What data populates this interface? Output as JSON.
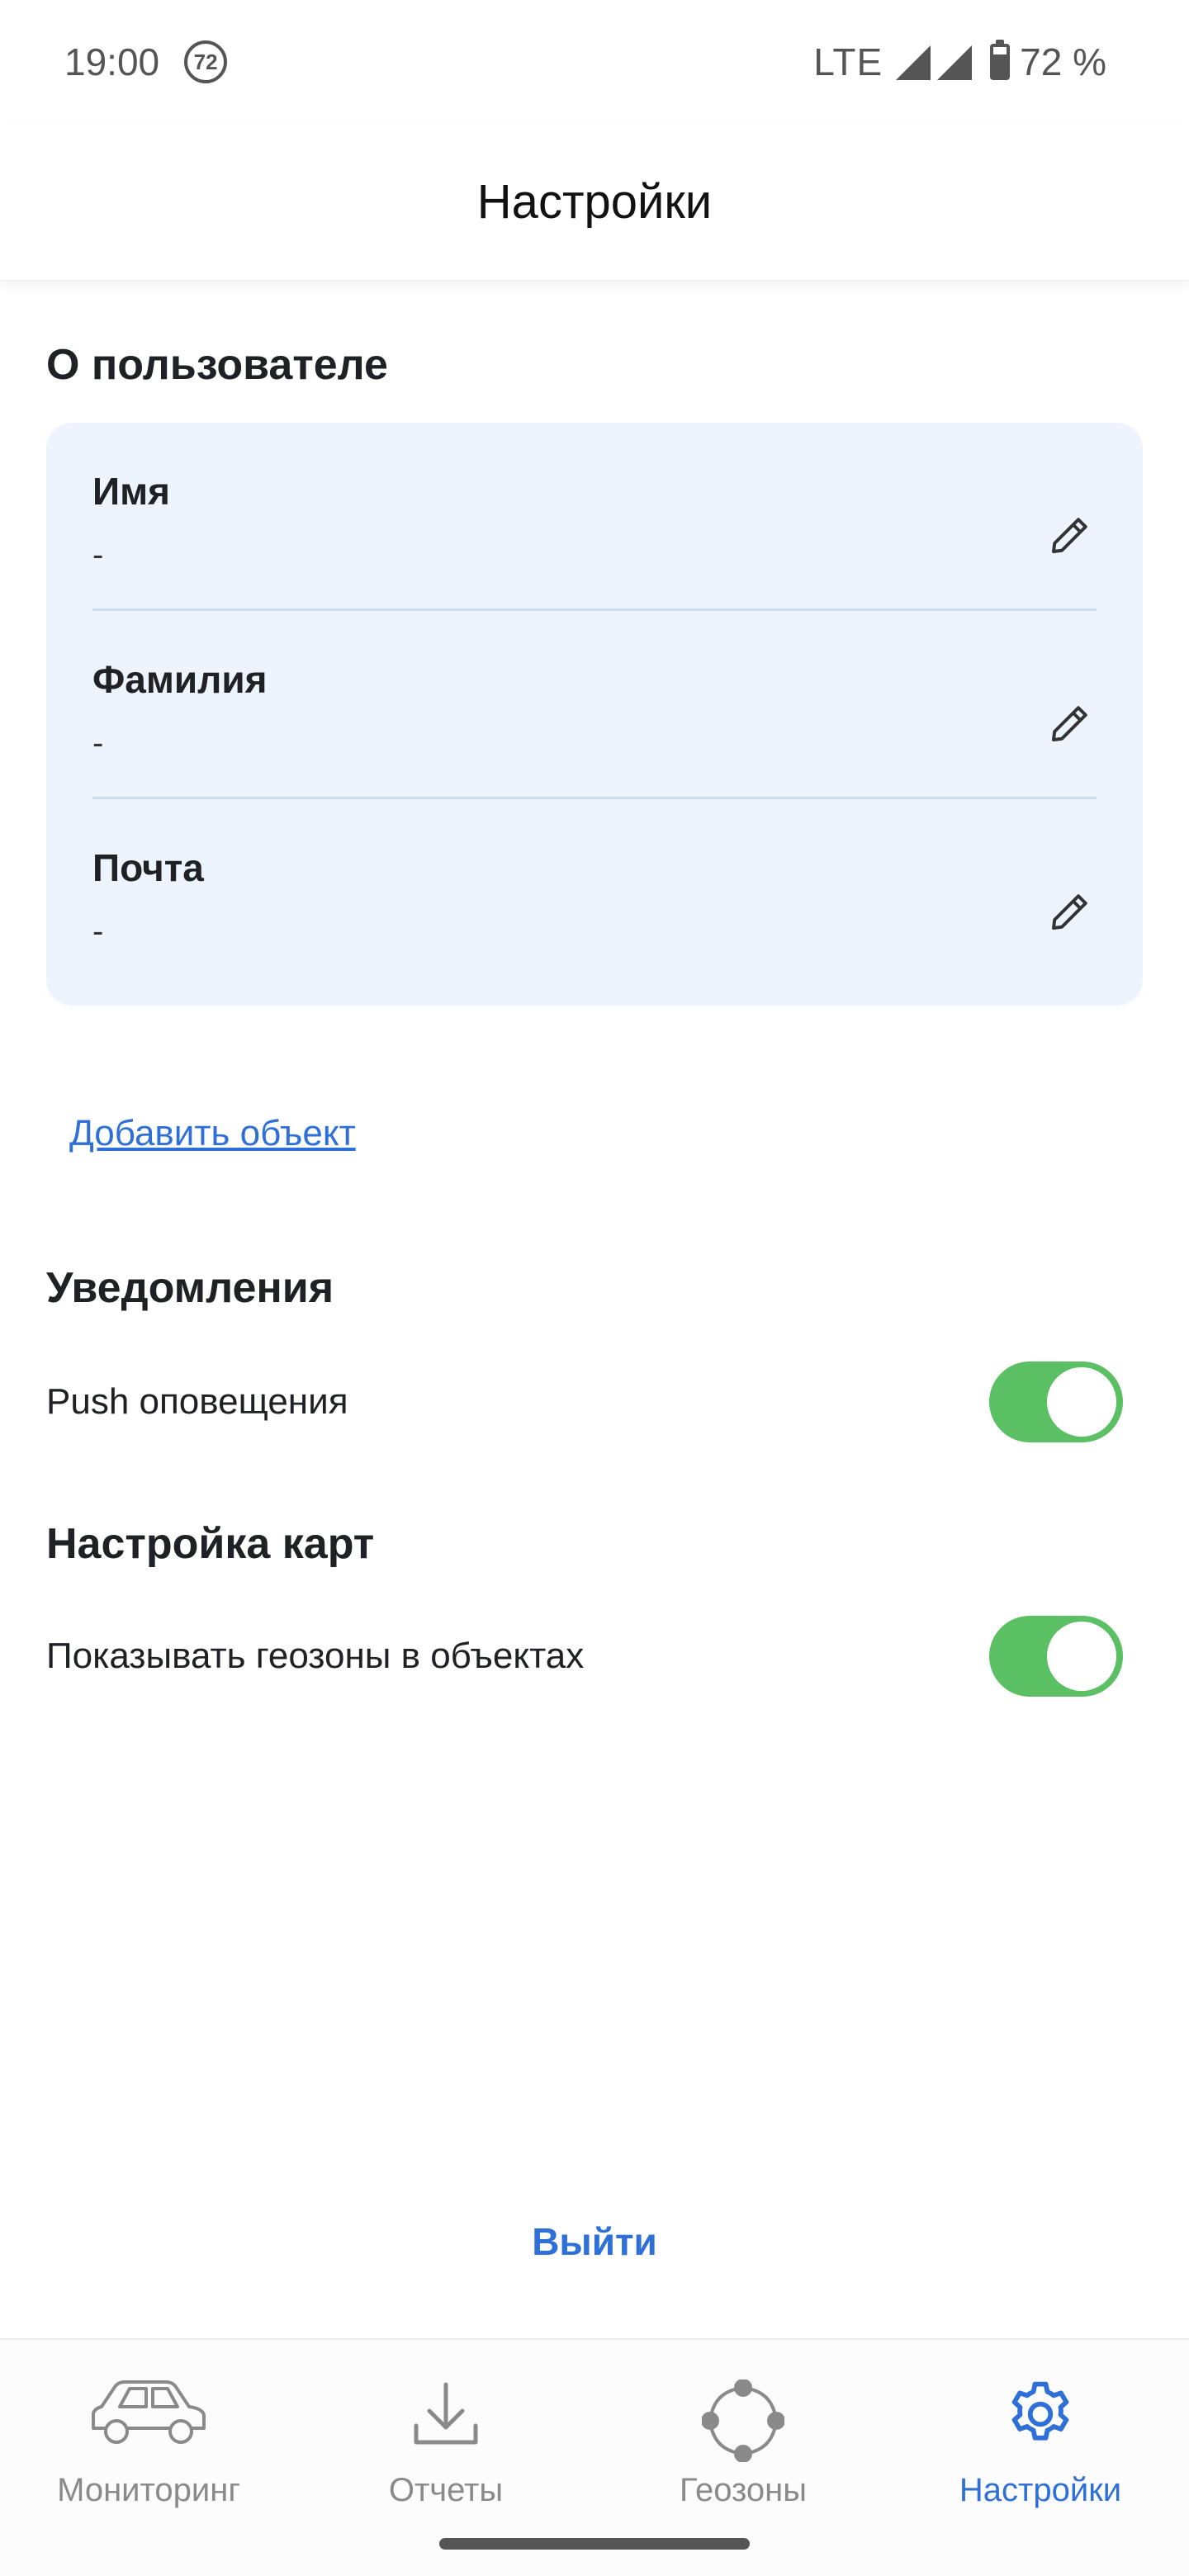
{
  "status_bar": {
    "time": "19:00",
    "notification_count": "72",
    "network": "LTE",
    "battery": "72 %"
  },
  "header": {
    "title": "Настройки"
  },
  "user_section": {
    "title": "О пользователе",
    "fields": [
      {
        "label": "Имя",
        "value": "-"
      },
      {
        "label": "Фамилия",
        "value": "-"
      },
      {
        "label": "Почта",
        "value": "-"
      }
    ]
  },
  "add_object_link": "Добавить объект",
  "notifications_section": {
    "title": "Уведомления",
    "push_label": "Push оповещения",
    "push_enabled": true
  },
  "map_section": {
    "title": "Настройка карт",
    "geozones_label": "Показывать геозоны в объектах",
    "geozones_enabled": true
  },
  "logout_label": "Выйти",
  "bottom_nav": {
    "items": [
      {
        "label": "Мониторинг",
        "icon": "car-icon",
        "active": false
      },
      {
        "label": "Отчеты",
        "icon": "download-icon",
        "active": false
      },
      {
        "label": "Геозоны",
        "icon": "geozone-icon",
        "active": false
      },
      {
        "label": "Настройки",
        "icon": "gear-icon",
        "active": true
      }
    ]
  },
  "colors": {
    "accent": "#2f6fd8",
    "toggle_on": "#5bbf63",
    "card_bg": "#eef4fe",
    "inactive_nav": "#8a8a8a"
  }
}
